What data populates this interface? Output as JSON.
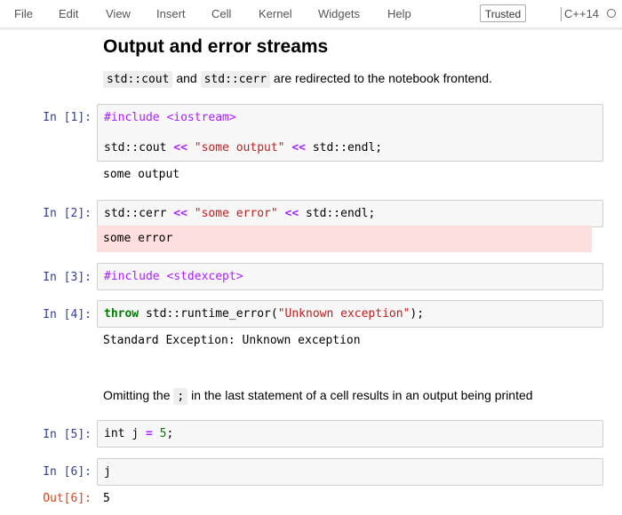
{
  "menubar": {
    "items": [
      "File",
      "Edit",
      "View",
      "Insert",
      "Cell",
      "Kernel",
      "Widgets",
      "Help"
    ],
    "trusted_label": "Trusted",
    "kernel_name": "C++14"
  },
  "notebook": {
    "heading": "Output and error streams",
    "intro": {
      "code1": "std::cout",
      "mid": " and ",
      "code2": "std::cerr",
      "rest": " are redirected to the notebook frontend."
    },
    "cells": [
      {
        "prompt": "In [1]:",
        "lines": [
          [
            {
              "t": "#include <iostream>",
              "c": "meta"
            }
          ],
          [
            {
              "t": "std::cout ",
              "c": ""
            },
            {
              "t": "<<",
              "c": "op"
            },
            {
              "t": " ",
              "c": ""
            },
            {
              "t": "\"some output\"",
              "c": "str"
            },
            {
              "t": " ",
              "c": ""
            },
            {
              "t": "<<",
              "c": "op"
            },
            {
              "t": " std::endl;",
              "c": ""
            }
          ]
        ],
        "output": "some output"
      },
      {
        "prompt": "In [2]:",
        "lines": [
          [
            {
              "t": "std::cerr ",
              "c": ""
            },
            {
              "t": "<<",
              "c": "op"
            },
            {
              "t": " ",
              "c": ""
            },
            {
              "t": "\"some error\"",
              "c": "str"
            },
            {
              "t": " ",
              "c": ""
            },
            {
              "t": "<<",
              "c": "op"
            },
            {
              "t": " std::endl;",
              "c": ""
            }
          ]
        ],
        "stderr": "some error"
      },
      {
        "prompt": "In [3]:",
        "lines": [
          [
            {
              "t": "#include <stdexcept>",
              "c": "meta"
            }
          ]
        ]
      },
      {
        "prompt": "In [4]:",
        "lines": [
          [
            {
              "t": "throw",
              "c": "kw"
            },
            {
              "t": " std::runtime_error(",
              "c": ""
            },
            {
              "t": "\"Unknown exception\"",
              "c": "str"
            },
            {
              "t": ");",
              "c": ""
            }
          ]
        ],
        "output": "Standard Exception: Unknown exception"
      },
      {
        "prompt": "In [5]:",
        "lines": [
          [
            {
              "t": "int j ",
              "c": ""
            },
            {
              "t": "=",
              "c": "op"
            },
            {
              "t": " ",
              "c": ""
            },
            {
              "t": "5",
              "c": "num"
            },
            {
              "t": ";",
              "c": ""
            }
          ]
        ]
      },
      {
        "prompt": "In [6]:",
        "lines": [
          [
            {
              "t": "j",
              "c": ""
            }
          ]
        ],
        "out_prompt": "Out[6]:",
        "output": "5"
      }
    ],
    "semicolon_note": {
      "pre": "Omitting the ",
      "code": ";",
      "post": " in the last statement of a cell results in an output being printed"
    }
  },
  "colors": {
    "prompt_in": "#303f9f",
    "prompt_out": "#d84315",
    "stderr_bg": "#fddede",
    "code_bg": "#f7f7f7"
  }
}
